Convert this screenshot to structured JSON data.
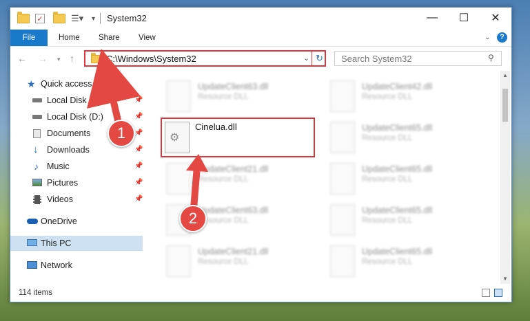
{
  "window": {
    "title": "System32",
    "items_count": "114 items"
  },
  "ribbon": {
    "tabs": [
      "File",
      "Home",
      "Share",
      "View"
    ]
  },
  "address": {
    "path": "C:\\Windows\\System32",
    "search_placeholder": "Search System32"
  },
  "sidebar": {
    "items": [
      {
        "label": "Quick access",
        "icon": "star-icon",
        "pinned": false
      },
      {
        "label": "Local Disk (C:)",
        "icon": "drive-icon",
        "pinned": true
      },
      {
        "label": "Local Disk (D:)",
        "icon": "drive-icon",
        "pinned": true
      },
      {
        "label": "Documents",
        "icon": "documents-icon",
        "pinned": true
      },
      {
        "label": "Downloads",
        "icon": "download-arrow-icon",
        "pinned": true
      },
      {
        "label": "Music",
        "icon": "music-note-icon",
        "pinned": true
      },
      {
        "label": "Pictures",
        "icon": "pictures-icon",
        "pinned": true
      },
      {
        "label": "Videos",
        "icon": "film-icon",
        "pinned": true
      },
      {
        "label": "OneDrive",
        "icon": "cloud-icon",
        "pinned": false
      },
      {
        "label": "This PC",
        "icon": "computer-icon",
        "pinned": false,
        "selected": true
      },
      {
        "label": "Network",
        "icon": "network-icon",
        "pinned": false
      }
    ]
  },
  "files": [
    {
      "name": "UpdateClient63.dll",
      "type": "Resource DLL"
    },
    {
      "name": "UpdateClient42.dll",
      "type": "Resource DLL"
    },
    {
      "name": "UpdateClient65.dll",
      "type": "Resource DLL"
    },
    {
      "name": "UpdateClient21.dll",
      "type": "Resource DLL"
    },
    {
      "name": "UpdateClient65.dll",
      "type": "Resource DLL"
    },
    {
      "name": "UpdateClient63.dll",
      "type": "Resource DLL"
    },
    {
      "name": "UpdateClient65.dll",
      "type": "Resource DLL"
    },
    {
      "name": "UpdateClient21.dll",
      "type": "Resource DLL"
    },
    {
      "name": "UpdateClient65.dll",
      "type": "Resource DLL"
    }
  ],
  "highlighted_file": {
    "name": "Cinelua.dll"
  },
  "annotations": {
    "step1": "1",
    "step2": "2",
    "color": "#e0353a"
  }
}
